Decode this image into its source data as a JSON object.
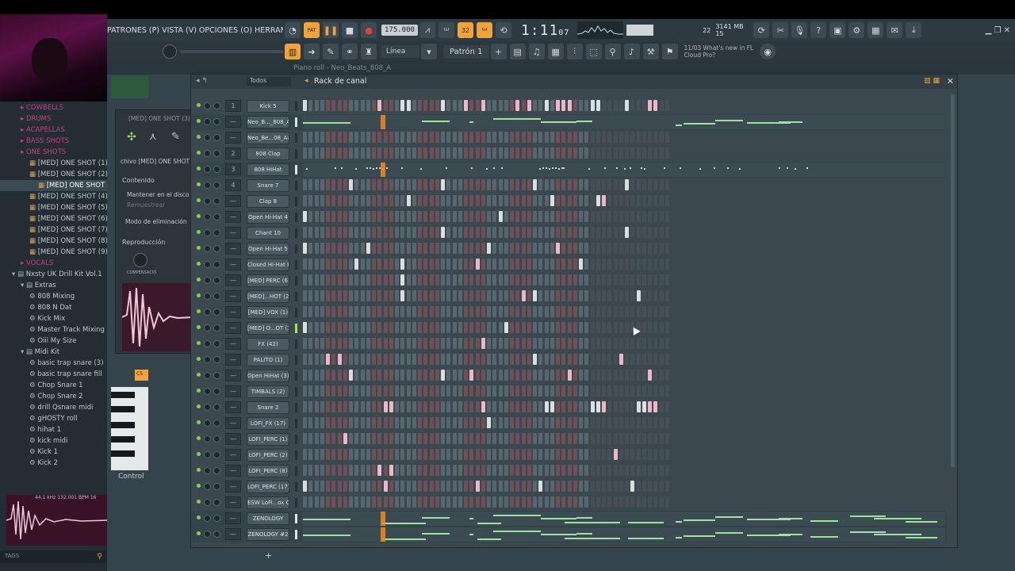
{
  "menu_text": "PATRONES (P)  VISTA (V)  OPCIONES (O)  HERRAMIENTAS (T)  AYUDA",
  "transport": {
    "pat_label": "PAT",
    "song_label": "SONG",
    "tempo": "175.000",
    "song_time_main": "1:11",
    "song_time_sub": "07",
    "step_label": "32"
  },
  "stats": {
    "cpu": "22",
    "ram": "3141 MB",
    "voices": "15"
  },
  "toolbar2": {
    "snap": "Línea",
    "pattern": "Patrón 1",
    "news_date": "11/03",
    "news_line1": "What's new in FL",
    "news_line2": "Cloud Pro?"
  },
  "piano_roll": {
    "title": "Piano roll - Neo_Beats_808_A",
    "control_label": "Control"
  },
  "browser": {
    "items": [
      {
        "label": "COWBELLS",
        "kind": "pink",
        "indent": 2
      },
      {
        "label": "DRUMS",
        "kind": "pink",
        "indent": 2
      },
      {
        "label": "ACAPELLAS",
        "kind": "pink",
        "indent": 2
      },
      {
        "label": "BASS SHOTS",
        "kind": "pink",
        "indent": 2
      },
      {
        "label": "ONE SHOTS",
        "kind": "pink",
        "indent": 2
      },
      {
        "label": "[MED] ONE SHOT (1)",
        "kind": "file",
        "indent": 3
      },
      {
        "label": "[MED] ONE SHOT (2)",
        "kind": "file",
        "indent": 3
      },
      {
        "label": "[MED] ONE SHOT (3)",
        "kind": "file-sel",
        "indent": 4
      },
      {
        "label": "[MED] ONE SHOT (4)",
        "kind": "file",
        "indent": 3
      },
      {
        "label": "[MED] ONE SHOT (5)",
        "kind": "file",
        "indent": 3
      },
      {
        "label": "[MED] ONE SHOT (6)",
        "kind": "file",
        "indent": 3
      },
      {
        "label": "[MED] ONE SHOT (7)",
        "kind": "file",
        "indent": 3
      },
      {
        "label": "[MED] ONE SHOT (8)",
        "kind": "file",
        "indent": 3
      },
      {
        "label": "[MED] ONE SHOT (9)",
        "kind": "file",
        "indent": 3
      },
      {
        "label": "VOCALS",
        "kind": "pink",
        "indent": 2
      },
      {
        "label": "Nxsty UK Drill Kit Vol.1",
        "kind": "folder",
        "indent": 1
      },
      {
        "label": "Extras",
        "kind": "folder",
        "indent": 2
      },
      {
        "label": "808 Mixing",
        "kind": "item",
        "indent": 3
      },
      {
        "label": "808 N Dat",
        "kind": "item",
        "indent": 3
      },
      {
        "label": "Kick Mix",
        "kind": "item",
        "indent": 3
      },
      {
        "label": "Master Track Mixing",
        "kind": "item",
        "indent": 3
      },
      {
        "label": "Oiii My Size",
        "kind": "item",
        "indent": 3
      },
      {
        "label": "Midi Kit",
        "kind": "folder",
        "indent": 2
      },
      {
        "label": "basic trap snare (3)",
        "kind": "item",
        "indent": 3
      },
      {
        "label": "basic trap snare fill",
        "kind": "item",
        "indent": 3
      },
      {
        "label": "Chop Snare 1",
        "kind": "item",
        "indent": 3
      },
      {
        "label": "Chop Snare 2",
        "kind": "item",
        "indent": 3
      },
      {
        "label": "drill Qsnare midi",
        "kind": "item",
        "indent": 3
      },
      {
        "label": "gHOSTY roll",
        "kind": "item",
        "indent": 3
      },
      {
        "label": "hihat 1",
        "kind": "item",
        "indent": 3
      },
      {
        "label": "kick midi",
        "kind": "item",
        "indent": 3
      },
      {
        "label": "Kick 1",
        "kind": "item",
        "indent": 3
      },
      {
        "label": "Kick 2",
        "kind": "item",
        "indent": 3
      }
    ],
    "wave_info": "44.1 kHz  132.001 BPM  16",
    "tags_label": "TAGS"
  },
  "channel_settings": {
    "header": "[MED] ONE SHOT (3)",
    "file_label": "chivo  [MED] ONE SHOT (",
    "contenido": "Contenido",
    "mantener": "Mantener en el disco",
    "remuestrear": "Remuestrear",
    "modo": "Modo de eliminación",
    "reproduccion": "Reproducción",
    "compensacion": "COMPENSACIÓ"
  },
  "rack": {
    "title": "Rack de canal",
    "filter": "Todos",
    "channels": [
      {
        "name": "Kick 5",
        "mixer": "1",
        "type": "steps",
        "sel": "off",
        "on": [
          0,
          13,
          17,
          18,
          24,
          28,
          31,
          37,
          39,
          42,
          44,
          45,
          46,
          50,
          51,
          56,
          60,
          61
        ]
      },
      {
        "name": "Neo_B..._808_A",
        "mixer": "—",
        "type": "roll",
        "sel": "white",
        "highlight": true
      },
      {
        "name": "Neo_Be...08_A#",
        "mixer": "—",
        "type": "steps",
        "sel": "off",
        "on": []
      },
      {
        "name": "808 Clap",
        "mixer": "2",
        "type": "steps",
        "sel": "off",
        "on": []
      },
      {
        "name": "808 HiHat",
        "mixer": "3",
        "type": "ticks",
        "sel": "white",
        "highlight": true
      },
      {
        "name": "Snare 7",
        "mixer": "4",
        "type": "steps",
        "sel": "off",
        "on": [
          8,
          24,
          40,
          56
        ]
      },
      {
        "name": "Clap 8",
        "mixer": "—",
        "type": "steps",
        "sel": "off",
        "on": [
          18,
          43,
          51,
          52
        ]
      },
      {
        "name": "Open Hi-Hat 4",
        "mixer": "—",
        "type": "steps",
        "sel": "off",
        "on": [
          0,
          34
        ]
      },
      {
        "name": "Chant 10",
        "mixer": "—",
        "type": "steps",
        "sel": "off",
        "on": [
          24,
          56
        ]
      },
      {
        "name": "Open Hi-Hat 5",
        "mixer": "—",
        "type": "steps",
        "sel": "off",
        "on": [
          0,
          11,
          32,
          44
        ]
      },
      {
        "name": "Closed Hi-Hat 8",
        "mixer": "—",
        "type": "steps",
        "sel": "off",
        "on": [
          9,
          17,
          30,
          48
        ]
      },
      {
        "name": "[MED] PERC (6)",
        "mixer": "—",
        "type": "steps",
        "sel": "off",
        "on": [
          17
        ]
      },
      {
        "name": "[MED]...HOT (2)",
        "mixer": "—",
        "type": "steps",
        "sel": "off",
        "on": [
          17,
          38,
          40,
          58
        ]
      },
      {
        "name": "[MED] VOX (1)",
        "mixer": "—",
        "type": "steps",
        "sel": "off",
        "on": []
      },
      {
        "name": "[MED] O...OT (3)",
        "mixer": "—",
        "type": "steps",
        "sel": "on",
        "on": [
          0,
          35
        ]
      },
      {
        "name": "FX (42)",
        "mixer": "—",
        "type": "steps",
        "sel": "off",
        "on": [
          31
        ]
      },
      {
        "name": "PALITO (1)",
        "mixer": "—",
        "type": "steps",
        "sel": "off",
        "on": [
          4,
          6,
          40,
          55
        ]
      },
      {
        "name": "Open HiHat (3)",
        "mixer": "—",
        "type": "steps",
        "sel": "off",
        "on": [
          8,
          24,
          29,
          46,
          60
        ]
      },
      {
        "name": "TIMBALS (2)",
        "mixer": "—",
        "type": "steps",
        "sel": "off",
        "on": []
      },
      {
        "name": "Snare 2",
        "mixer": "—",
        "type": "steps",
        "sel": "off",
        "on": [
          14,
          15,
          31,
          42,
          43,
          50,
          51,
          52,
          58,
          59,
          60,
          61
        ]
      },
      {
        "name": "LOFI_FX (17)",
        "mixer": "—",
        "type": "steps",
        "sel": "off",
        "on": [
          32
        ]
      },
      {
        "name": "LOFI_PERC (1)",
        "mixer": "—",
        "type": "steps",
        "sel": "off",
        "on": [
          7
        ]
      },
      {
        "name": "LOFI_PERC (2)",
        "mixer": "—",
        "type": "steps",
        "sel": "off",
        "on": [
          54
        ]
      },
      {
        "name": "LOFI_PERC (8)",
        "mixer": "—",
        "type": "steps",
        "sel": "off",
        "on": [
          13,
          15
        ]
      },
      {
        "name": "LOFI_PERC (17)",
        "mixer": "—",
        "type": "steps",
        "sel": "off",
        "on": [
          0,
          14,
          30,
          41,
          57
        ]
      },
      {
        "name": "ESW LoFi...ox Off",
        "mixer": "—",
        "type": "steps",
        "sel": "off",
        "on": []
      },
      {
        "name": "ZENOLOGY",
        "mixer": "—",
        "type": "roll",
        "sel": "white",
        "highlight": true
      },
      {
        "name": "ZENOLOGY #2",
        "mixer": "—",
        "type": "roll",
        "sel": "white",
        "highlight": true
      }
    ]
  },
  "colors": {
    "accent": "#f3a23a",
    "note": "#9ee3a4",
    "step_on": "#d9dee1",
    "step_on_red": "#efb7c6",
    "browser_pink": "#d23a8a"
  }
}
